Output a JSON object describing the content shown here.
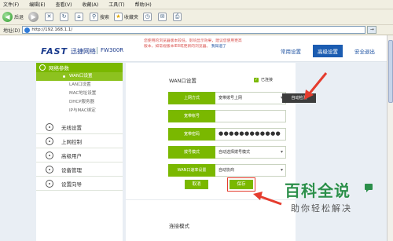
{
  "browser": {
    "menu": [
      "文件(F)",
      "编辑(E)",
      "查看(V)",
      "收藏(A)",
      "工具(T)",
      "帮助(H)"
    ],
    "toolbar": {
      "back": "后退",
      "search": "搜索",
      "favorites": "收藏夹"
    },
    "address_label": "地址(D)",
    "address_url": "http://192.168.1.1/"
  },
  "header": {
    "brand": "FAST",
    "brand_cn": "迅捷网络",
    "model": "FW300R",
    "notice_text": "您使用的浏览器版本较低，影响显示效果，建议您使用更高版本，如常规版本IE8或更新的浏览器。",
    "notice_link": "我知道了",
    "nav": [
      {
        "label": "常用设置",
        "active": false
      },
      {
        "label": "高级设置",
        "active": true
      },
      {
        "label": "安全退出",
        "active": false
      }
    ]
  },
  "sidebar": {
    "active_group": "网络参数",
    "sub_items": [
      {
        "label": "WAN口设置",
        "current": true
      },
      {
        "label": "LAN口设置",
        "current": false
      },
      {
        "label": "MAC地址设置",
        "current": false
      },
      {
        "label": "DHCP服务器",
        "current": false
      },
      {
        "label": "IP与MAC绑定",
        "current": false
      }
    ],
    "items": [
      "无线设置",
      "上网控制",
      "高级用户",
      "设备管理",
      "设置向导"
    ]
  },
  "panel": {
    "title": "WAN口设置",
    "status": "已连接",
    "auto_detect": "自动检测",
    "fields": [
      {
        "label": "上网方式",
        "value": "宽带拨号上网",
        "type": "select"
      },
      {
        "label": "宽带帐号",
        "value": "",
        "type": "text"
      },
      {
        "label": "宽带密码",
        "value": "●●●●●●●●●●●●",
        "type": "password"
      },
      {
        "label": "拨号模式",
        "value": "自动选择拨号模式",
        "type": "select"
      },
      {
        "label": "WAN口速率设置",
        "value": "自动协商",
        "type": "select"
      }
    ],
    "buttons": {
      "cancel": "取消",
      "save": "保存"
    },
    "section2_title": "连接模式"
  },
  "watermark": {
    "title": "百科全说",
    "subtitle": "助你轻松解决"
  },
  "colors": {
    "accent_green": "#7ab800",
    "nav_blue": "#1b5cb1",
    "highlight_red": "#e53c2e",
    "brand_blue": "#1a3a8c"
  }
}
